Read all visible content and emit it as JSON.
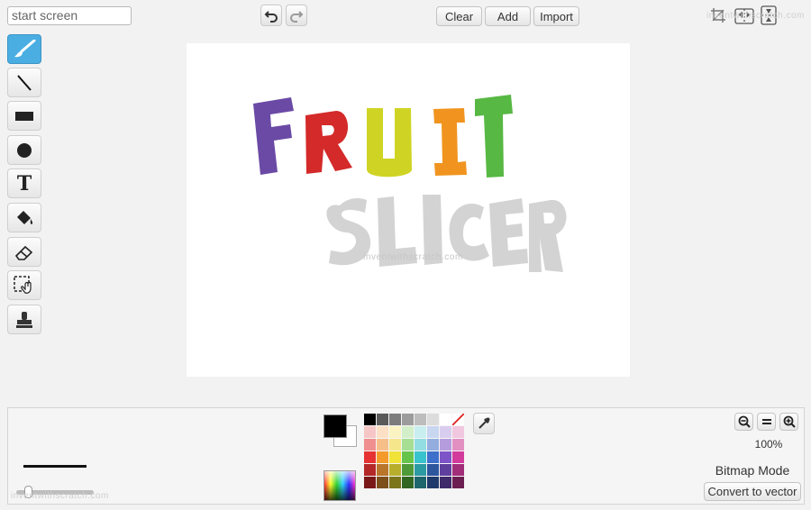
{
  "costume_name": {
    "value": "start screen"
  },
  "toolbar": {
    "clear_label": "Clear",
    "add_label": "Add",
    "import_label": "Import"
  },
  "tools": [
    {
      "name": "paintbrush-tool",
      "icon": "paintbrush-icon",
      "active": true
    },
    {
      "name": "line-tool",
      "icon": "line-icon"
    },
    {
      "name": "rectangle-tool",
      "icon": "rectangle-icon"
    },
    {
      "name": "ellipse-tool",
      "icon": "ellipse-icon"
    },
    {
      "name": "text-tool",
      "icon": "text-icon"
    },
    {
      "name": "fill-tool",
      "icon": "paint-bucket-icon"
    },
    {
      "name": "eraser-tool",
      "icon": "eraser-icon"
    },
    {
      "name": "select-tool",
      "icon": "select-icon"
    },
    {
      "name": "stamp-tool",
      "icon": "stamp-icon"
    }
  ],
  "canvas_art": {
    "fruit_letters": [
      {
        "char": "F",
        "color": "#6a4aa5"
      },
      {
        "char": "R",
        "color": "#d42a2a"
      },
      {
        "char": "U",
        "color": "#cfd424"
      },
      {
        "char": "I",
        "color": "#f0941f"
      },
      {
        "char": "T",
        "color": "#57b843"
      }
    ],
    "slicer_text": "SLICER",
    "slicer_color": "#d3d3d3"
  },
  "watermark": "inventwithscratch.com",
  "colors": {
    "foreground": "#000000",
    "background": "#ffffff",
    "accent": "#4aaee3"
  },
  "palette": [
    "#000000",
    "#5a5a5a",
    "#7c7c7c",
    "#9c9c9c",
    "#bdbdbd",
    "#dcdcdc",
    "#ffffff",
    "none",
    "#f6c6c6",
    "#fbe0c6",
    "#fbf4c2",
    "#d3efc9",
    "#c9eef0",
    "#c8d6f0",
    "#d9cdef",
    "#f1c7e0",
    "#ef8f8f",
    "#f6bf8a",
    "#f6e68b",
    "#a6de94",
    "#92dde2",
    "#93addf",
    "#b59ddd",
    "#e28fc2",
    "#e63232",
    "#f39a2a",
    "#f1e237",
    "#67c44b",
    "#39c3cc",
    "#3e70cb",
    "#7d54c7",
    "#d23b9c",
    "#b52828",
    "#b9752a",
    "#b9ae2c",
    "#4f9a38",
    "#2c9aa1",
    "#2e569d",
    "#5f3f9d",
    "#a22d79",
    "#7a1818",
    "#7d4f1b",
    "#7c751c",
    "#326623",
    "#1d666b",
    "#1f3a6a",
    "#3f2a6a",
    "#6c1e51"
  ],
  "zoom": {
    "level": "100%"
  },
  "mode": {
    "label": "Bitmap Mode",
    "convert_label": "Convert to vector"
  }
}
